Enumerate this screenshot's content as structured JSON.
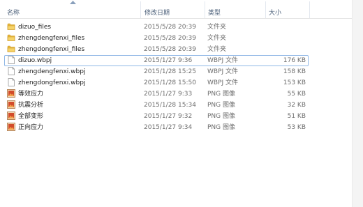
{
  "header": {
    "name_label": "名称",
    "date_label": "修改日期",
    "type_label": "类型",
    "size_label": "大小"
  },
  "files": [
    {
      "name": "dizuo_files",
      "date": "2015/5/28 20:39",
      "type": "文件夹",
      "size": "",
      "icon": "folder-icon"
    },
    {
      "name": "zhengdengfenxi_files",
      "date": "2015/5/28 20:39",
      "type": "文件夹",
      "size": "",
      "icon": "folder-icon"
    },
    {
      "name": "zhengdongfenxi_files",
      "date": "2015/5/28 20:39",
      "type": "文件夹",
      "size": "",
      "icon": "folder-icon"
    },
    {
      "name": "dizuo.wbpj",
      "date": "2015/1/27 9:36",
      "type": "WBPJ 文件",
      "size": "176 KB",
      "icon": "document-icon",
      "selected": true
    },
    {
      "name": "zhengdengfenxi.wbpj",
      "date": "2015/1/28 15:25",
      "type": "WBPJ 文件",
      "size": "158 KB",
      "icon": "document-icon"
    },
    {
      "name": "zhengdongfenxi.wbpj",
      "date": "2015/1/28 15:50",
      "type": "WBPJ 文件",
      "size": "153 KB",
      "icon": "document-icon"
    },
    {
      "name": "等效应力",
      "date": "2015/1/27 9:33",
      "type": "PNG 图像",
      "size": "55 KB",
      "icon": "image-icon"
    },
    {
      "name": "抗震分析",
      "date": "2015/1/28 15:34",
      "type": "PNG 图像",
      "size": "32 KB",
      "icon": "image-icon"
    },
    {
      "name": "全部变形",
      "date": "2015/1/27 9:32",
      "type": "PNG 图像",
      "size": "51 KB",
      "icon": "image-icon"
    },
    {
      "name": "正向应力",
      "date": "2015/1/27 9:34",
      "type": "PNG 图像",
      "size": "53 KB",
      "icon": "image-icon"
    }
  ]
}
